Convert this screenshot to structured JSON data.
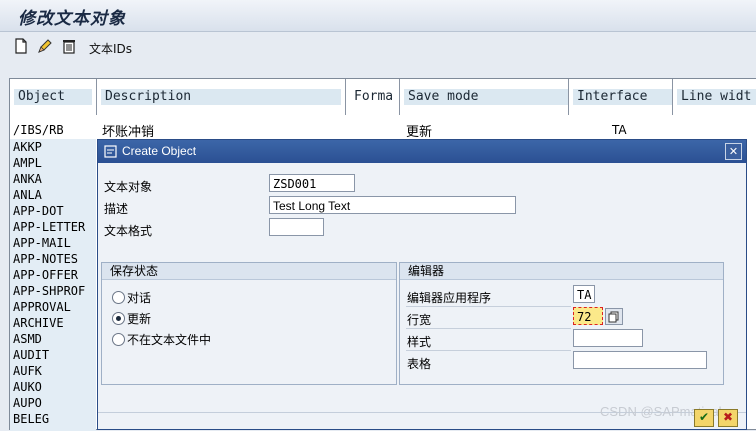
{
  "window": {
    "title": "修改文本对象"
  },
  "toolbar": {
    "create_icon": "new-document-icon",
    "edit_icon": "pencil-icon",
    "delete_icon": "trash-icon",
    "text_ids_label": "文本IDs"
  },
  "table": {
    "columns": [
      "Object",
      "Description",
      "Forma",
      "Save mode",
      "Interface",
      "Line widt"
    ],
    "first_row": {
      "object": "/IBS/RB",
      "description": "坏账冲销",
      "save_mode": "更新",
      "interface": "TA"
    },
    "objects": [
      "AKKP",
      "AMPL",
      "ANKA",
      "ANLA",
      "APP-DOT",
      "APP-LETTER",
      "APP-MAIL",
      "APP-NOTES",
      "APP-OFFER",
      "APP-SHPROF",
      "APPROVAL",
      "ARCHIVE",
      "ASMD",
      "AUDIT",
      "AUFK",
      "AUKO",
      "AUPO",
      "BELEG"
    ]
  },
  "dialog": {
    "title": "Create Object",
    "close_label": "✕",
    "text_object_label": "文本对象",
    "text_object_value": "ZSD001",
    "description_label": "描述",
    "description_value": "Test Long Text",
    "text_format_label": "文本格式",
    "text_format_value": "",
    "save_status": {
      "header": "保存状态",
      "options": [
        "对话",
        "更新",
        "不在文本文件中"
      ],
      "selected": "更新"
    },
    "editor": {
      "header": "编辑器",
      "app_label": "编辑器应用程序",
      "app_value": "TA",
      "line_width_label": "行宽",
      "line_width_value": "72",
      "style_label": "样式",
      "style_value": "",
      "form_label": "表格",
      "form_value": ""
    },
    "ok_label": "✔",
    "cancel_label": "✖"
  },
  "watermark": "CSDN @SAPmatinal",
  "colors": {
    "dialog_title": "#2b5093",
    "header_label_bg": "#dbe8f1",
    "object_column_bg": "#e3edf5"
  }
}
